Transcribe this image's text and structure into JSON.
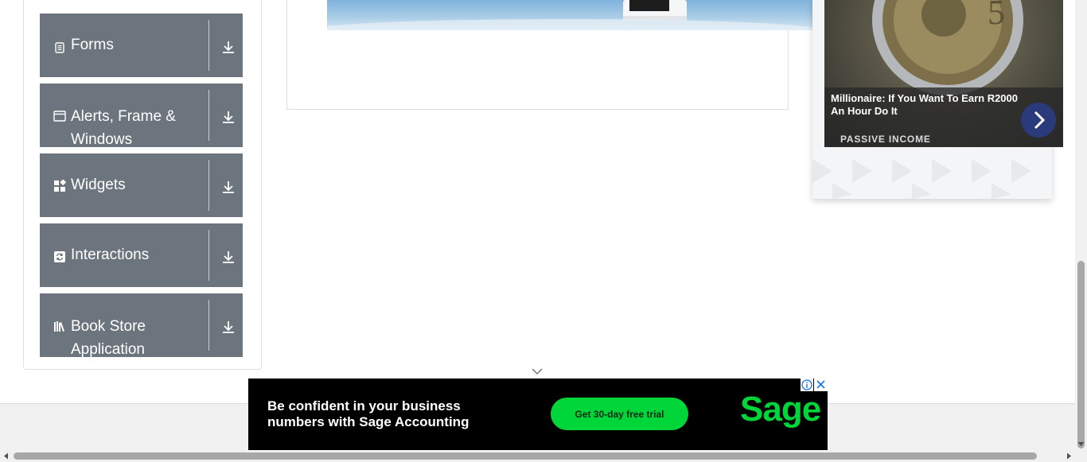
{
  "sidebar": {
    "groups": [
      {
        "label": "Forms",
        "icon": "document-icon"
      },
      {
        "label": "Alerts, Frame & Windows",
        "icon": "window-icon"
      },
      {
        "label": "Widgets",
        "icon": "widgets-icon"
      },
      {
        "label": "Interactions",
        "icon": "refresh-icon"
      },
      {
        "label": "Book Store Application",
        "icon": "books-icon"
      }
    ],
    "group_color": "#6c757d"
  },
  "right_ad": {
    "title": "Millionaire: If You Want To Earn R2000 An Hour Do It",
    "sponsor": "PASSIVE INCOME"
  },
  "bottom_ad": {
    "headline": "Be confident in your business numbers with Sage Accounting",
    "cta": "Get 30-day free trial",
    "brand": "Sage",
    "accent_color": "#00d639"
  }
}
